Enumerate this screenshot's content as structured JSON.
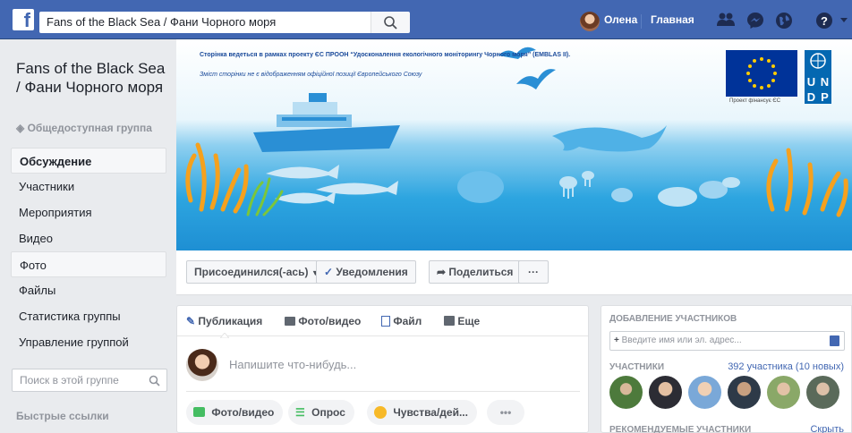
{
  "topbar": {
    "logo": "f",
    "search_value": "Fans of the Black Sea / Фани Чорного моря",
    "user_name": "Олена",
    "home_label": "Главная"
  },
  "group": {
    "title": "Fans of the Black Sea / Фани Чорного моря",
    "type": "Общедоступная группа"
  },
  "nav": {
    "items": [
      "Обсуждение",
      "Участники",
      "Мероприятия",
      "Видео",
      "Фото",
      "Файлы",
      "Статистика группы",
      "Управление группой"
    ]
  },
  "left_search_placeholder": "Поиск в этой группе",
  "quick_links_label": "Быстрые ссылки",
  "cover": {
    "line1": "Сторінка ведеться в рамках проекту ЄС ПРООН “Удосконалення екологічного моніторингу Чорного моря” (EMBLAS II).",
    "line2": "Зміст сторінки не є відображенням офіційної позиції Європейського Союзу",
    "eu_caption": "Проект фінансує ЄС",
    "undp_letters": [
      "U",
      "N",
      "D",
      "P"
    ]
  },
  "actions": {
    "joined": "Присоединился(-ась)",
    "notifications": "Уведомления",
    "share": "Поделиться",
    "more": "···"
  },
  "composer": {
    "tabs": [
      "Публикация",
      "Фото/видео",
      "Файл",
      "Еще"
    ],
    "placeholder": "Напишите что-нибудь...",
    "pills": [
      "Фото/видео",
      "Опрос",
      "Чувства/дей..."
    ],
    "more": "•••"
  },
  "sidebar": {
    "add_members_heading": "ДОБАВЛЕНИЕ УЧАСТНИКОВ",
    "add_placeholder": "Введите имя или эл. адрес...",
    "members_heading": "УЧАСТНИКИ",
    "members_count": "392 участника (10 новых)",
    "recommended_heading": "РЕКОМЕНДУЕМЫЕ УЧАСТНИКИ",
    "hide_label": "Скрыть"
  },
  "colors": {
    "brand": "#4267b2",
    "link": "#4267b2",
    "sea": "#29a3df",
    "seaweed": "#f5a11e"
  }
}
